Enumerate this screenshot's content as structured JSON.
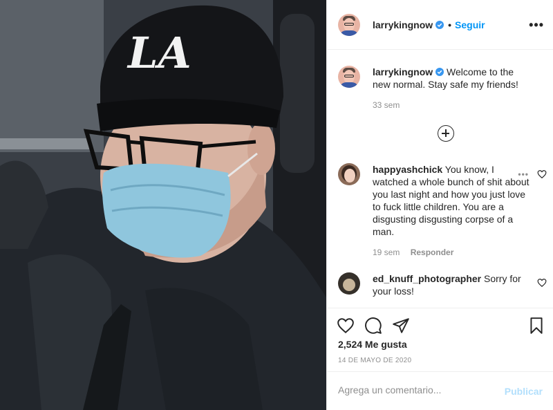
{
  "post": {
    "image_alt_icon": "photo",
    "header": {
      "username": "larrykingnow",
      "separator": "•",
      "follow_label": "Seguir",
      "more_label": "•••"
    },
    "caption": {
      "username": "larrykingnow",
      "text": "Welcome to the new normal. Stay safe my friends!",
      "time": "33 sem"
    },
    "comments": [
      {
        "username": "happyashchick",
        "text": "You know, I watched a whole bunch of shit about you last night and how you just love to fuck little children. You are a disgusting disgusting corpse of a man.",
        "time": "19 sem",
        "reply_label": "Responder",
        "more_label": "•••"
      },
      {
        "username": "ed_knuff_photographer",
        "text": "Sorry for your loss!"
      }
    ],
    "likes": "2,524 Me gusta",
    "date": "14 DE MAYO DE 2020",
    "comment_placeholder": "Agrega un comentario...",
    "publish_label": "Publicar",
    "colors": {
      "accent": "#0095f6",
      "publish_disabled": "#b2dffc",
      "secondary_text": "#8e8e8e",
      "border": "#efefef"
    }
  }
}
